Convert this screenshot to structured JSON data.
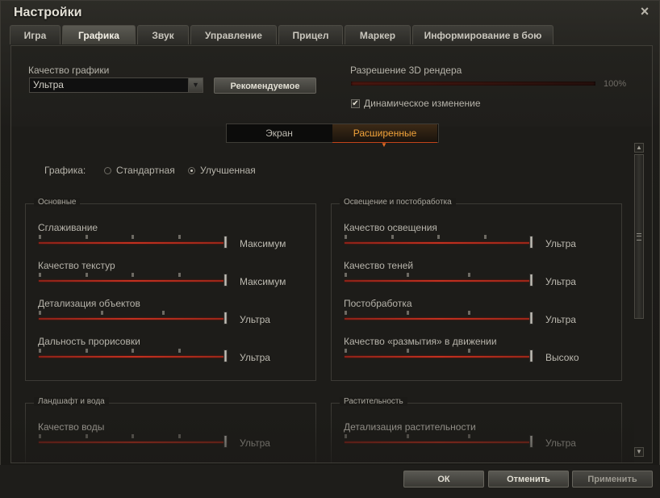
{
  "window": {
    "title": "Настройки",
    "close_icon": "×"
  },
  "tabs": [
    {
      "label": "Игра"
    },
    {
      "label": "Графика",
      "active": true
    },
    {
      "label": "Звук"
    },
    {
      "label": "Управление"
    },
    {
      "label": "Прицел"
    },
    {
      "label": "Маркер"
    },
    {
      "label": "Информирование в бою"
    }
  ],
  "quality": {
    "label": "Качество графики",
    "selected": "Ультра",
    "recommended_button": "Рекомендуемое"
  },
  "render_resolution": {
    "label": "Разрешение 3D рендера",
    "value_text": "100%",
    "value": 100,
    "dynamic_checkbox_label": "Динамическое изменение",
    "dynamic_checked": true
  },
  "subtabs": [
    {
      "label": "Экран"
    },
    {
      "label": "Расширенные",
      "active": true
    }
  ],
  "graphics_mode": {
    "label": "Графика:",
    "options": [
      {
        "label": "Стандартная",
        "selected": false
      },
      {
        "label": "Улучшенная",
        "selected": true
      }
    ]
  },
  "groups": {
    "main": {
      "title": "Основные",
      "settings": [
        {
          "label": "Сглаживание",
          "value": "Максимум",
          "steps": 5,
          "level": 4
        },
        {
          "label": "Качество текстур",
          "value": "Максимум",
          "steps": 5,
          "level": 4
        },
        {
          "label": "Детализация объектов",
          "value": "Ультра",
          "steps": 4,
          "level": 3
        },
        {
          "label": "Дальность прорисовки",
          "value": "Ультра",
          "steps": 5,
          "level": 4
        }
      ]
    },
    "lighting": {
      "title": "Освещение и постобработка",
      "settings": [
        {
          "label": "Качество освещения",
          "value": "Ультра",
          "steps": 5,
          "level": 4
        },
        {
          "label": "Качество теней",
          "value": "Ультра",
          "steps": 4,
          "level": 3
        },
        {
          "label": "Постобработка",
          "value": "Ультра",
          "steps": 4,
          "level": 3
        },
        {
          "label": "Качество «размытия» в движении",
          "value": "Высоко",
          "steps": 4,
          "level": 3
        }
      ]
    },
    "landscape": {
      "title": "Ландшафт и вода",
      "settings": [
        {
          "label": "Качество воды",
          "value": "Ультра",
          "steps": 5,
          "level": 4
        }
      ]
    },
    "vegetation": {
      "title": "Растительность",
      "settings": [
        {
          "label": "Детализация растительности",
          "value": "Ультра",
          "steps": 4,
          "level": 3
        }
      ]
    }
  },
  "footer": {
    "ok": "ОК",
    "cancel": "Отменить",
    "apply": "Применить"
  }
}
